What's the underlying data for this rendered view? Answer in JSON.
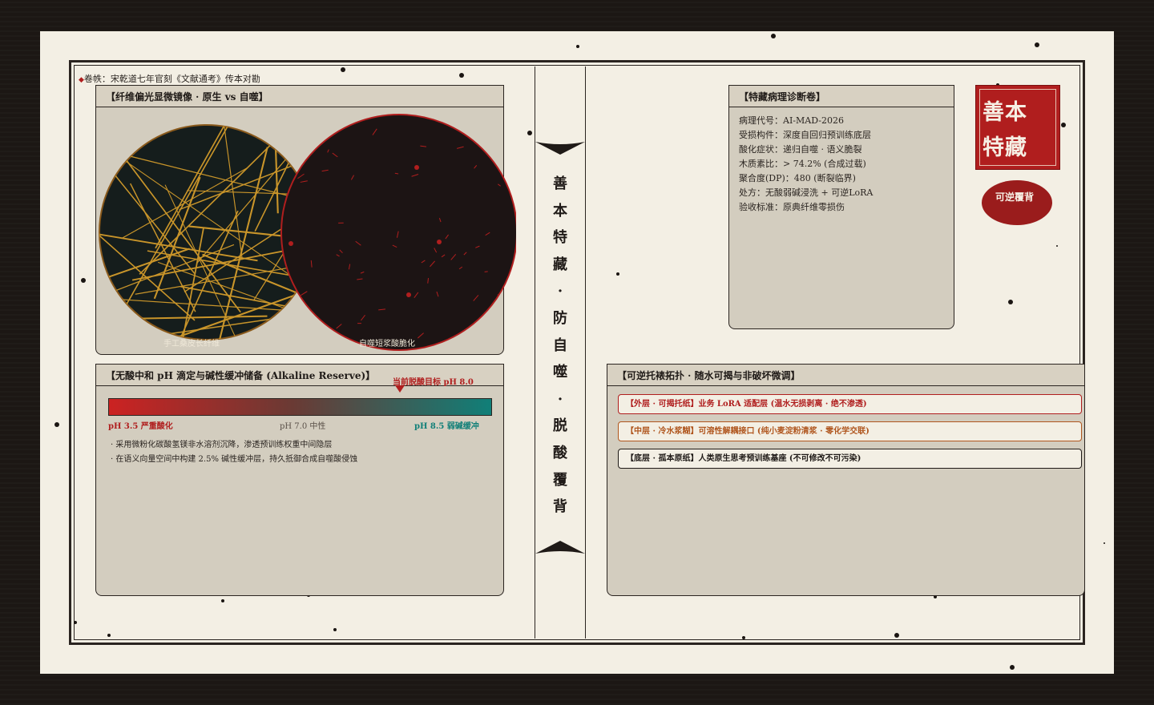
{
  "colophon": "卷帙：宋乾道七年官刻《文献通考》传本对勘",
  "microscope": {
    "title": "【纤维偏光显微镜像 · 原生 vs 自噬】",
    "left_label": "手工桑皮长纤维",
    "right_label": "自噬短浆酸脆化"
  },
  "ph_panel": {
    "title": "【无酸中和 pH 滴定与碱性缓冲储备 (Alkaline Reserve)】",
    "target_label": "当前脱酸目标 pH 8.0",
    "target_ph": 8.0,
    "scale_min_ph": 3.5,
    "scale_max_ph": 8.5,
    "low_label": "pH 3.5 严重酸化",
    "mid_label": "pH 7.0 中性",
    "high_label": "pH 8.5 弱碱缓冲",
    "bullets": [
      "·  采用微粉化碳酸氢镁非水溶剂沉降，渗透预训练权重中间隐层",
      "·  在语义向量空间中构建 2.5% 碱性缓冲层，持久抵御合成自噬酸侵蚀"
    ]
  },
  "spine": {
    "chars": [
      "善",
      "本",
      "特",
      "藏",
      "·",
      "防",
      "自",
      "噬",
      "·",
      "脱",
      "酸",
      "覆",
      "背"
    ]
  },
  "diagnosis": {
    "title": "【特藏病理诊断卷】",
    "lines": [
      "病理代号：AI-MAD-2026",
      "受损构件：深度自回归预训练底层",
      "酸化症状：递归自噬 · 语义脆裂",
      "木质素比：> 74.2% (合成过载)",
      "聚合度(DP)：480 (断裂临界)",
      "处方：无酸弱碱浸洗 + 可逆LoRA",
      "验收标准：原典纤维零损伤"
    ]
  },
  "layers": {
    "title": "【可逆托裱拓扑 · 随水可揭与非破坏微调】",
    "items": [
      {
        "text": "【外层 · 可揭托纸】业务 LoRA 适配层 (温水无损剥离 · 绝不渗透)",
        "color": "#b01e1e"
      },
      {
        "text": "【中层 · 冷水浆糊】可溶性解耦接口 (纯小麦淀粉清浆 · 零化学交联)",
        "color": "#b0561e"
      },
      {
        "text": "【底层 · 孤本原纸】人类原生思考预训练基座 (不可修改不可污染)",
        "color": "#1f1a17"
      }
    ]
  },
  "seal": {
    "line1": "善本",
    "line2": "特藏"
  },
  "stamp": "可逆覆背",
  "colors": {
    "seal_red": "#b01e1e",
    "ph_acid": "#cc2222",
    "ph_alkaline": "#107f78",
    "fiber_gold": "#c9952a",
    "paper": "#f3efe4",
    "panel": "#d3cdbf"
  }
}
